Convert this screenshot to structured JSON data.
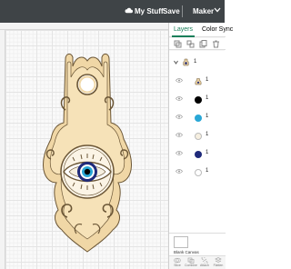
{
  "topbar": {
    "my_stuff": "My Stuff",
    "save": "Save",
    "machine": "Maker",
    "icons": [
      "cloud-icon",
      "chevron-down-icon"
    ]
  },
  "panel": {
    "tabs": [
      {
        "label": "Layers",
        "active": true
      },
      {
        "label": "Color Sync",
        "active": false
      }
    ],
    "group": {
      "label": "1"
    },
    "layers": [
      {
        "label": "1",
        "color": "#a8885a",
        "icon": "cut-icon"
      },
      {
        "label": "1",
        "color": "#000000"
      },
      {
        "label": "1",
        "color": "#29a7d6"
      },
      {
        "label": "1",
        "color": "#f6efe0"
      },
      {
        "label": "1",
        "color": "#1f2a7a"
      },
      {
        "label": "1",
        "color": "#ffffff"
      }
    ],
    "blank_canvas": "Blank Canvas",
    "bottom_tools": [
      {
        "label": "Slice",
        "icon": "slice-icon"
      },
      {
        "label": "Combine",
        "icon": "combine-icon"
      },
      {
        "label": "Attach",
        "icon": "attach-icon"
      },
      {
        "label": "Flatten",
        "icon": "flatten-icon"
      }
    ]
  },
  "colors": {
    "topbar_bg": "#3f4447",
    "accent": "#1a7f5a",
    "wood": "#f0d7a6",
    "wood_outline": "#6b5636"
  }
}
